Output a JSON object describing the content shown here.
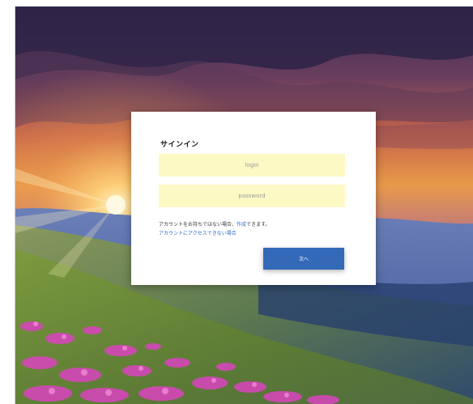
{
  "signin": {
    "title": "サインイン",
    "login_placeholder": "login",
    "password_placeholder": "password",
    "no_account_prefix": "アカウントをお持ちではない場合、",
    "create_link": "作成",
    "no_account_suffix": "できます。",
    "cant_access_link": "アカウントにアクセスできない場合",
    "next_button": "次へ"
  },
  "colors": {
    "field_bg": "#fdf9c4",
    "button_bg": "#3469b8",
    "link": "#2b6cc4"
  }
}
